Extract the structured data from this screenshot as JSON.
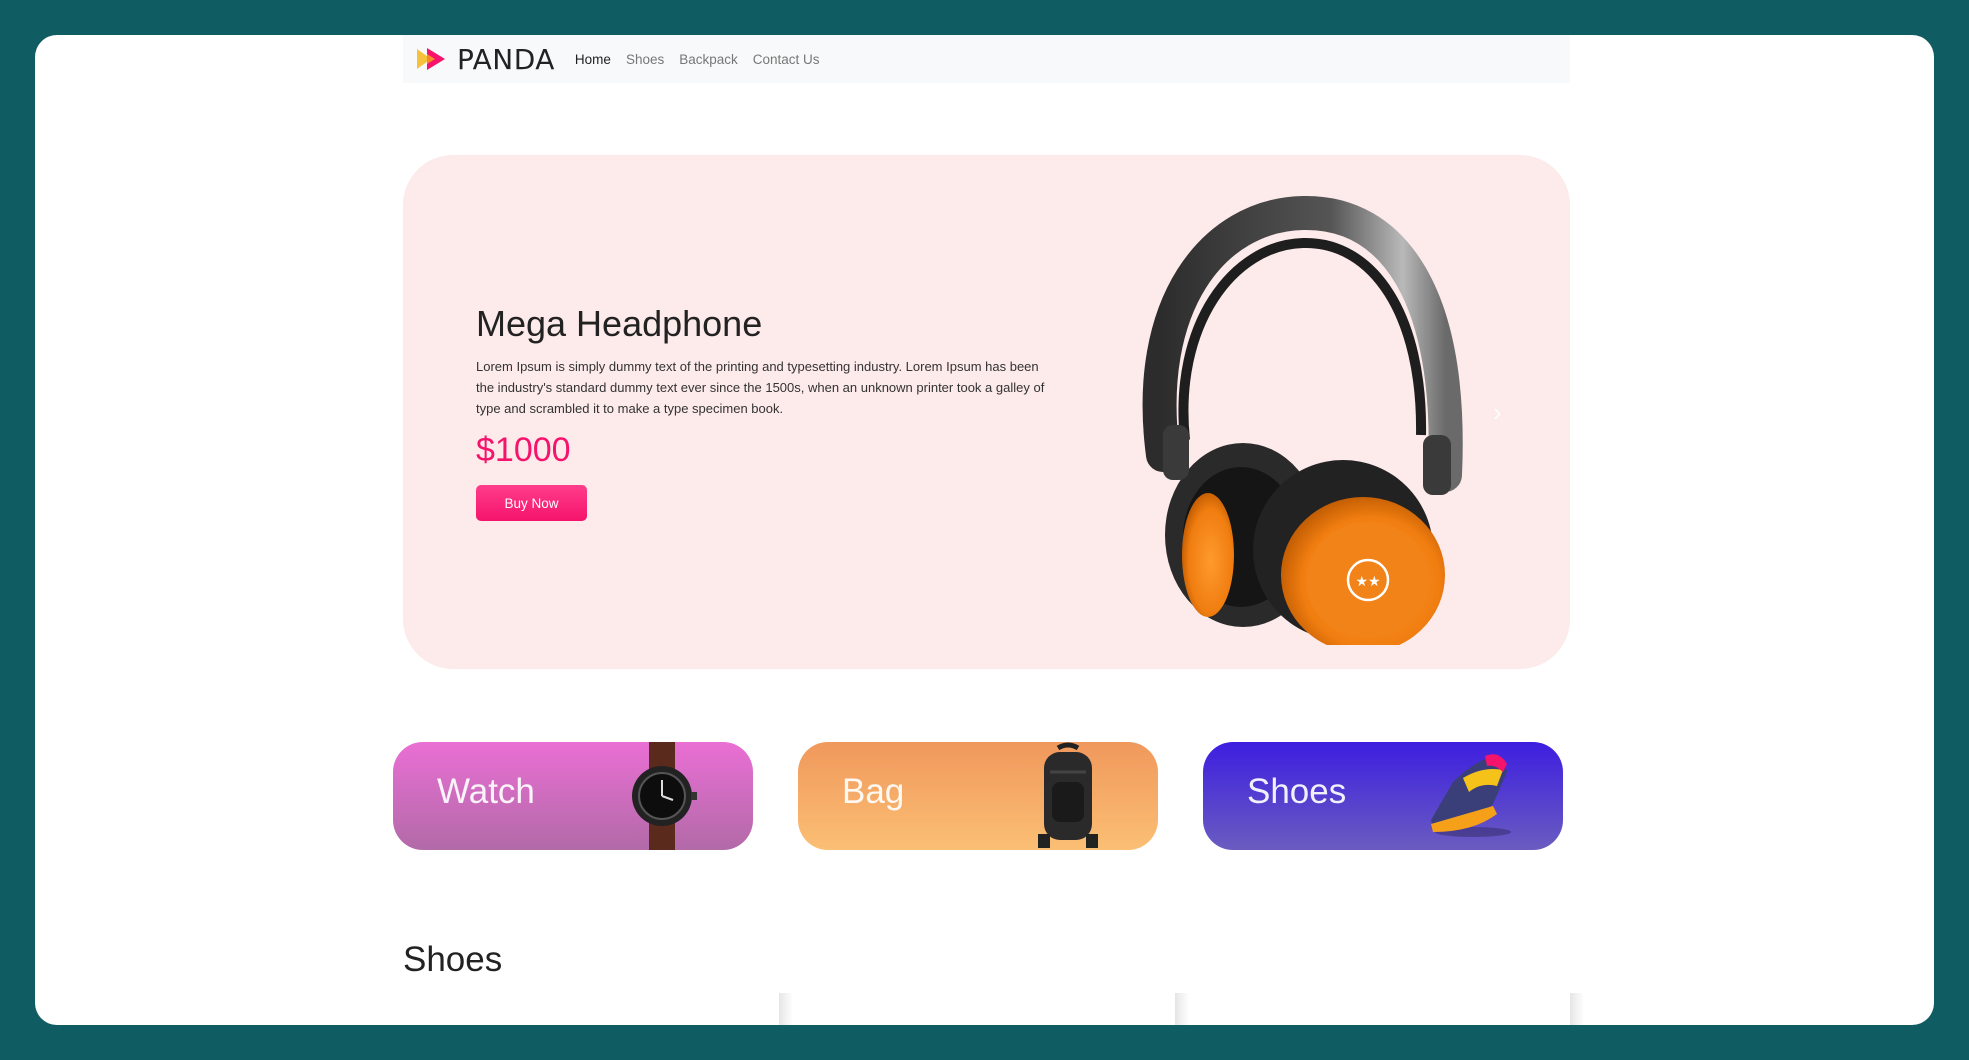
{
  "brand": {
    "name": "PANDA"
  },
  "nav": {
    "items": [
      {
        "label": "Home",
        "active": true
      },
      {
        "label": "Shoes",
        "active": false
      },
      {
        "label": "Backpack",
        "active": false
      },
      {
        "label": "Contact Us",
        "active": false
      }
    ]
  },
  "hero": {
    "title": "Mega Headphone",
    "description": "Lorem Ipsum is simply dummy text of the printing and typesetting industry. Lorem Ipsum has been the industry's standard dummy text ever since the 1500s, when an unknown printer took a galley of type and scrambled it to make a type specimen book.",
    "price": "$1000",
    "button_label": "Buy Now",
    "next_icon": "chevron-right-icon",
    "background_color": "#fdeaea",
    "accent_color": "#f5136c"
  },
  "categories": [
    {
      "label": "Watch",
      "icon": "watch-icon"
    },
    {
      "label": "Bag",
      "icon": "backpack-icon"
    },
    {
      "label": "Shoes",
      "icon": "sneaker-icon"
    }
  ],
  "section": {
    "title": "Shoes"
  }
}
